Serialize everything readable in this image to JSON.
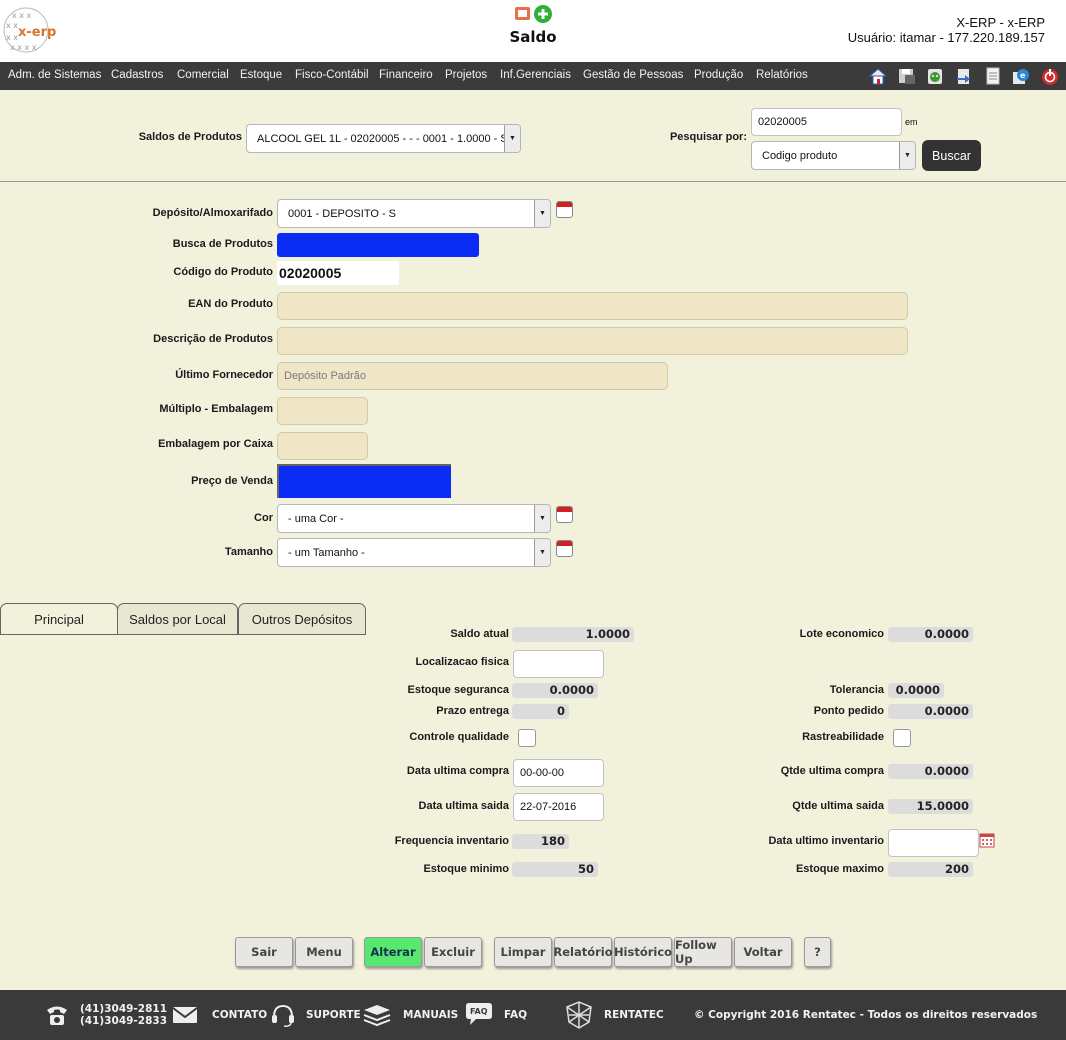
{
  "header": {
    "title": "Saldo",
    "system": "X-ERP - x-ERP",
    "user_line": "Usuário: itamar - 177.220.189.157",
    "logo_text": "x-erp"
  },
  "menu": [
    "Adm. de Sistemas",
    "Cadastros",
    "Comercial",
    "Estoque",
    "Fisco-Contábil",
    "Financeiro",
    "Projetos",
    "Inf.Gerenciais",
    "Gestão de Pessoas",
    "Produção",
    "Relatórios"
  ],
  "toolbar_icons": [
    "home-icon",
    "save-icon",
    "android-icon",
    "export-icon",
    "document-icon",
    "internet-explorer-icon",
    "power-icon"
  ],
  "search": {
    "saldos_label": "Saldos de Produtos",
    "saldos_value": "ALCOOL GEL 1L - 02020005 - - - 0001 - 1.0000 - S",
    "pesquisar_label": "Pesquisar por:",
    "pesquisar_value": "02020005",
    "em_label": "em",
    "criteria_value": "Codigo produto",
    "buscar_label": "Buscar"
  },
  "form": {
    "deposito_label": "Depósito/Almoxarifado",
    "deposito_value": "0001 - DEPOSITO - S",
    "busca_label": "Busca de Produtos",
    "codigo_label": "Código do Produto",
    "codigo_value": "02020005",
    "ean_label": "EAN do Produto",
    "descricao_label": "Descrição de Produtos",
    "fornecedor_label": "Último Fornecedor",
    "fornecedor_value": "Depósito Padrão",
    "multiplo_label": "Múltiplo - Embalagem",
    "embalagem_label": "Embalagem por Caixa",
    "preco_label": "Preço de Venda",
    "cor_label": "Cor",
    "cor_value": "- uma Cor -",
    "tamanho_label": "Tamanho",
    "tamanho_value": "- um Tamanho -"
  },
  "tabs": [
    "Principal",
    "Saldos por Local",
    "Outros Depósitos"
  ],
  "details": {
    "saldo_atual_label": "Saldo atual",
    "saldo_atual": "1.0000",
    "lote_label": "Lote economico",
    "lote": "0.0000",
    "localizacao_label": "Localizacao fisica",
    "estoque_seg_label": "Estoque seguranca",
    "estoque_seg": "0.0000",
    "tolerancia_label": "Tolerancia",
    "tolerancia": "0.0000",
    "prazo_label": "Prazo entrega",
    "prazo": "0",
    "ponto_label": "Ponto pedido",
    "ponto": "0.0000",
    "controle_label": "Controle qualidade",
    "rastreab_label": "Rastreabilidade",
    "data_compra_label": "Data ultima compra",
    "data_compra": "00-00-00",
    "qtde_compra_label": "Qtde ultima compra",
    "qtde_compra": "0.0000",
    "data_saida_label": "Data ultima saida",
    "data_saida": "22-07-2016",
    "qtde_saida_label": "Qtde ultima saida",
    "qtde_saida": "15.0000",
    "freq_label": "Frequencia inventario",
    "freq": "180",
    "data_inv_label": "Data ultimo inventario",
    "est_min_label": "Estoque minimo",
    "est_min": "50",
    "est_max_label": "Estoque maximo",
    "est_max": "200"
  },
  "buttons": {
    "sair": "Sair",
    "menu": "Menu",
    "alterar": "Alterar",
    "excluir": "Excluir",
    "limpar": "Limpar",
    "relatorio": "Relatório",
    "historico": "Histórico",
    "followup": "Follow Up",
    "voltar": "Voltar",
    "help": "?"
  },
  "footer": {
    "phone1": "(41)3049-2811",
    "phone2": "(41)3049-2833",
    "contato": "CONTATO",
    "suporte": "SUPORTE",
    "manuais": "MANUAIS",
    "faq_badge": "FAQ",
    "faq": "FAQ",
    "rentatec": "RENTATEC",
    "copyright": "© Copyright 2016 Rentatec - Todos os direitos reservados"
  },
  "colors": {
    "background": "#f2f1dc",
    "menubar": "#3b3b3b",
    "highlight_blue": "#0a2cf5",
    "alterar_green": "#58e86f",
    "footer": "#3a3a3a"
  }
}
